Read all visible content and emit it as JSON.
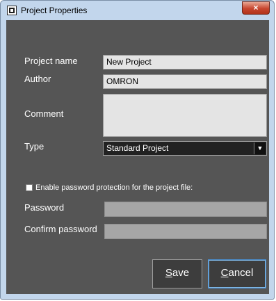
{
  "window": {
    "title": "Project Properties",
    "close_symbol": "×"
  },
  "form": {
    "project_name_label": "Project name",
    "project_name_value": "New Project",
    "author_label": "Author",
    "author_value": "OMRON",
    "comment_label": "Comment",
    "comment_value": "",
    "type_label": "Type",
    "type_value": "Standard Project",
    "password_protect_label": "Enable password protection for the project file:",
    "password_protect_checked": false,
    "password_label": "Password",
    "confirm_password_label": "Confirm password"
  },
  "buttons": {
    "save_mnemonic": "S",
    "save_rest": "ave",
    "cancel_mnemonic": "C",
    "cancel_rest": "ancel"
  },
  "icons": {
    "title_icon": "app-window-icon",
    "dropdown": "chevron-down-icon",
    "close": "close-icon"
  },
  "colors": {
    "client_bg": "#555555",
    "field_bg": "#e4e4e4",
    "disabled_field_bg": "#a6a6a6",
    "close_red": "#c7462f",
    "focus_blue": "#4a8ed0"
  }
}
